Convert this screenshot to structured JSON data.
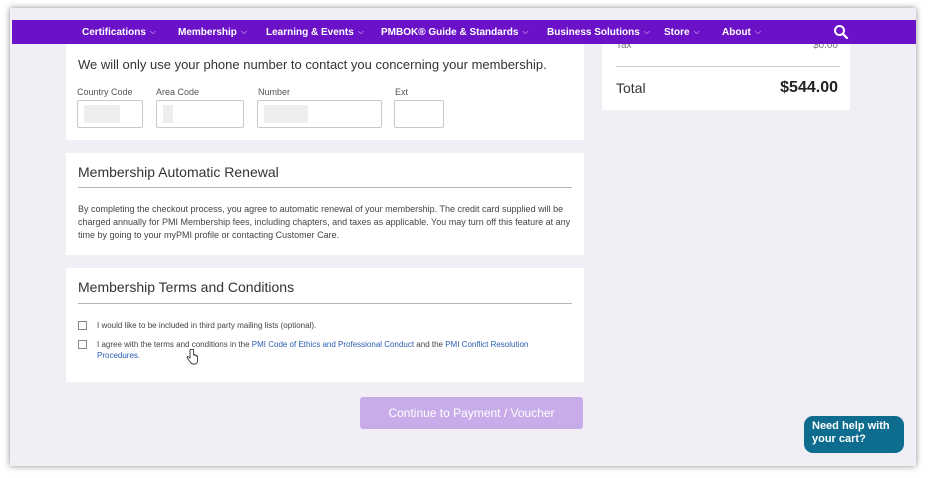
{
  "nav": {
    "items": [
      {
        "label": "Certifications"
      },
      {
        "label": "Membership"
      },
      {
        "label": "Learning & Events"
      },
      {
        "label": "PMBOK® Guide & Standards"
      },
      {
        "label": "Business Solutions"
      },
      {
        "label": "Store"
      },
      {
        "label": "About"
      }
    ],
    "search_icon": "search-icon"
  },
  "phone": {
    "intro": "We will only use your phone number to contact you concerning your membership.",
    "fields": [
      {
        "label": "Country Code"
      },
      {
        "label": "Area Code"
      },
      {
        "label": "Number"
      },
      {
        "label": "Ext"
      }
    ]
  },
  "renewal": {
    "title": "Membership Automatic Renewal",
    "text": "By completing the checkout process, you agree to automatic renewal of your membership. The credit card supplied will be charged annually for PMI Membership fees, including chapters, and taxes as applicable. You may turn off this feature at any time by going to your myPMI profile or contacting Customer Care."
  },
  "terms": {
    "title": "Membership Terms and Conditions",
    "mailing_label": "I would like to be included in third party mailing lists (optional).",
    "agree_prefix": "I agree with the terms and conditions in the ",
    "agree_link1": "PMI Code of Ethics and Professional Conduct",
    "agree_mid": " and the ",
    "agree_link2": "PMI Conflict Resolution Procedures",
    "agree_suffix": "."
  },
  "summary": {
    "tax_label": "Tax",
    "tax_value": "$0.00",
    "total_label": "Total",
    "total_value": "$544.00"
  },
  "continue_label": "Continue to Payment / Voucher",
  "help_label": "Need help with your cart?",
  "colors": {
    "nav": "#6b12c9",
    "button": "#c8acea",
    "help": "#0e6d8f",
    "link": "#2a5db0"
  }
}
